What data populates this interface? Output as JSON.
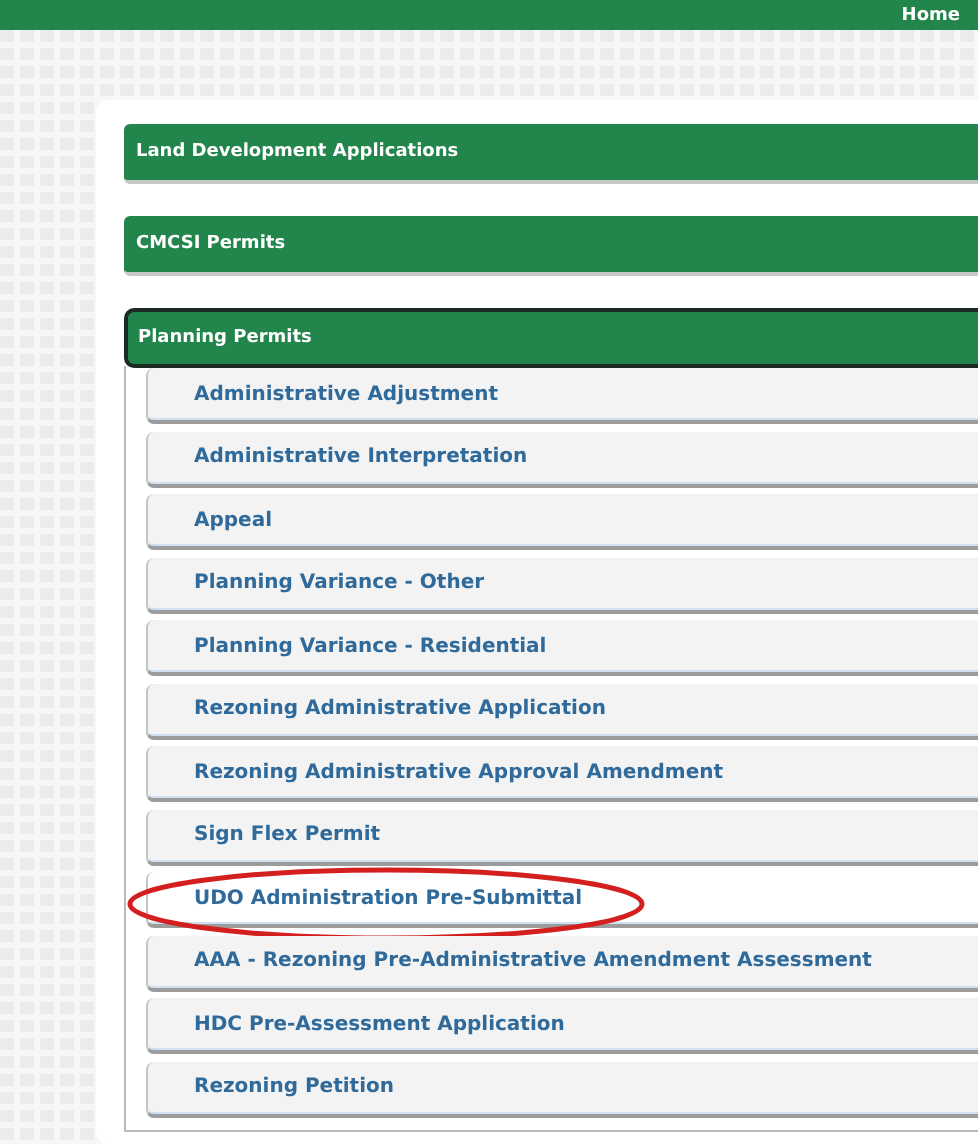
{
  "top_bar": {
    "home_link": "Home"
  },
  "sections": [
    {
      "title": "Land Development Applications",
      "expanded": false
    },
    {
      "title": "CMCSI Permits",
      "expanded": false
    },
    {
      "title": "Planning Permits",
      "expanded": true,
      "items": [
        {
          "label": "Administrative Adjustment",
          "selected": false,
          "circled": false
        },
        {
          "label": "Administrative Interpretation",
          "selected": false,
          "circled": false
        },
        {
          "label": "Appeal",
          "selected": false,
          "circled": false
        },
        {
          "label": "Planning Variance - Other",
          "selected": false,
          "circled": false
        },
        {
          "label": "Planning Variance - Residential",
          "selected": false,
          "circled": false
        },
        {
          "label": "Rezoning Administrative Application",
          "selected": false,
          "circled": false
        },
        {
          "label": "Rezoning Administrative Approval Amendment",
          "selected": false,
          "circled": false
        },
        {
          "label": "Sign Flex Permit",
          "selected": false,
          "circled": false
        },
        {
          "label": "UDO Administration Pre-Submittal",
          "selected": true,
          "circled": true
        },
        {
          "label": "AAA - Rezoning Pre-Administrative Amendment Assessment",
          "selected": false,
          "circled": false
        },
        {
          "label": "HDC Pre-Assessment Application",
          "selected": false,
          "circled": false
        },
        {
          "label": "Rezoning Petition",
          "selected": false,
          "circled": false
        }
      ]
    }
  ]
}
